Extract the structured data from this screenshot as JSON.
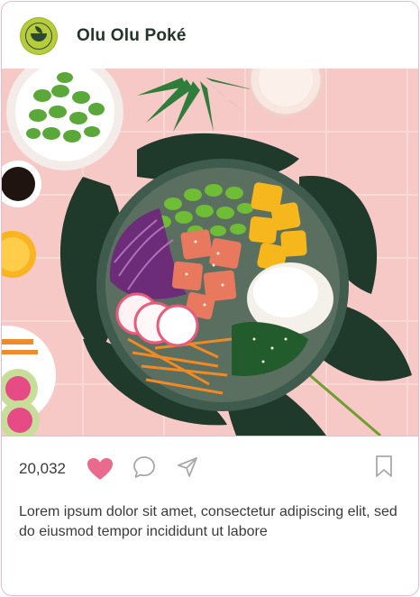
{
  "header": {
    "brand_name": "Olu Olu Poké",
    "avatar_icon": "poke-bowl-logo-icon"
  },
  "post": {
    "image_alt": "Poke bowl with salmon, edamame, mango, rice, radish and carrots on monstera leaves",
    "like_count": "20,032",
    "liked": true,
    "caption": "Lorem ipsum dolor sit amet, consectetur adipiscing elit, sed do eiusmod tempor incididunt ut labore"
  },
  "colors": {
    "accent_pink": "#e96a8d",
    "border_pink": "#f0b7c6",
    "brand_green": "#b6cc3d",
    "text_dark": "#23342b",
    "icon_gray": "#a9a9a9"
  },
  "icons": [
    "heart-icon",
    "comment-icon",
    "share-icon",
    "bookmark-icon"
  ]
}
